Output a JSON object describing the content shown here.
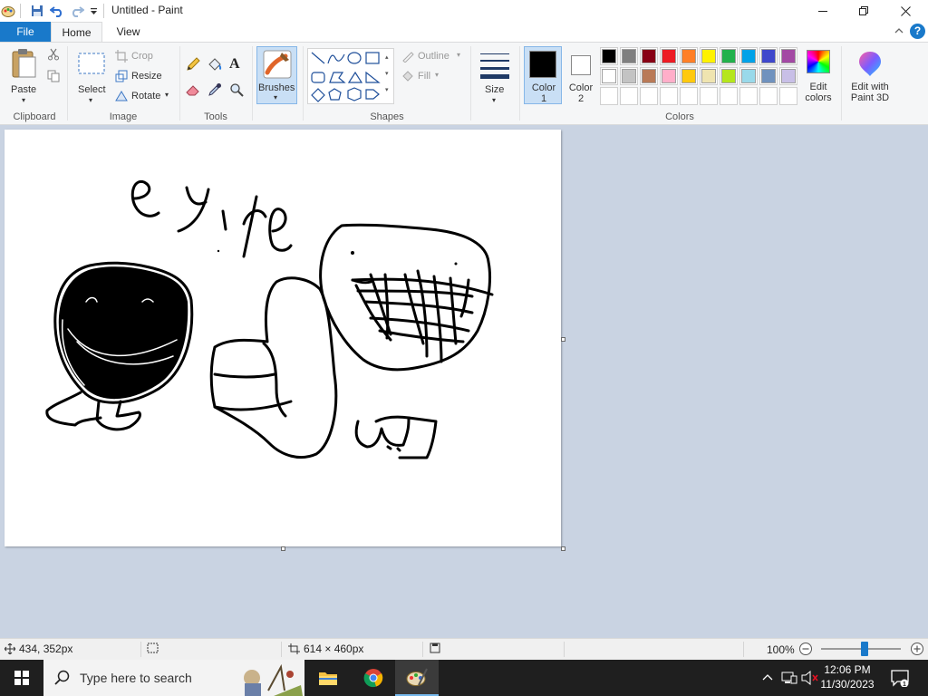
{
  "window": {
    "title": "Untitled - Paint",
    "quick_access": [
      "save-icon",
      "undo-icon",
      "redo-icon",
      "customize-icon"
    ]
  },
  "tabs": {
    "file": "File",
    "home": "Home",
    "view": "View"
  },
  "ribbon": {
    "clipboard": {
      "paste": "Paste",
      "label": "Clipboard"
    },
    "image": {
      "select": "Select",
      "crop": "Crop",
      "resize": "Resize",
      "rotate": "Rotate",
      "label": "Image"
    },
    "tools": {
      "label": "Tools"
    },
    "brushes": {
      "label": "Brushes"
    },
    "shapes": {
      "outline": "Outline",
      "fill": "Fill",
      "label": "Shapes"
    },
    "size": {
      "label": "Size"
    },
    "colors": {
      "color1": "Color 1",
      "color2": "Color 2",
      "edit": "Edit colors",
      "label": "Colors",
      "color1_value": "#000000",
      "color2_value": "#ffffff",
      "palette_row1": [
        "#000000",
        "#7f7f7f",
        "#880015",
        "#ed1c24",
        "#ff7f27",
        "#fff200",
        "#22b14c",
        "#00a2e8",
        "#3f48cc",
        "#a349a4"
      ],
      "palette_row2": [
        "#ffffff",
        "#c3c3c3",
        "#b97a57",
        "#ffaec9",
        "#ffc90e",
        "#efe4b0",
        "#b5e61d",
        "#99d9ea",
        "#7092be",
        "#c8bfe7"
      ]
    },
    "paint3d": "Edit with Paint 3D"
  },
  "canvas": {
    "handwriting": "eyile"
  },
  "statusbar": {
    "cursor": "434, 352px",
    "selection": "",
    "size": "614 × 460px",
    "zoom": "100%",
    "zoom_level": 0.55
  },
  "taskbar": {
    "search_placeholder": "Type here to search",
    "time": "12:06 PM",
    "date": "11/30/2023"
  },
  "colors": {
    "accent": "#1979ca",
    "workspace": "#c9d3e2"
  }
}
